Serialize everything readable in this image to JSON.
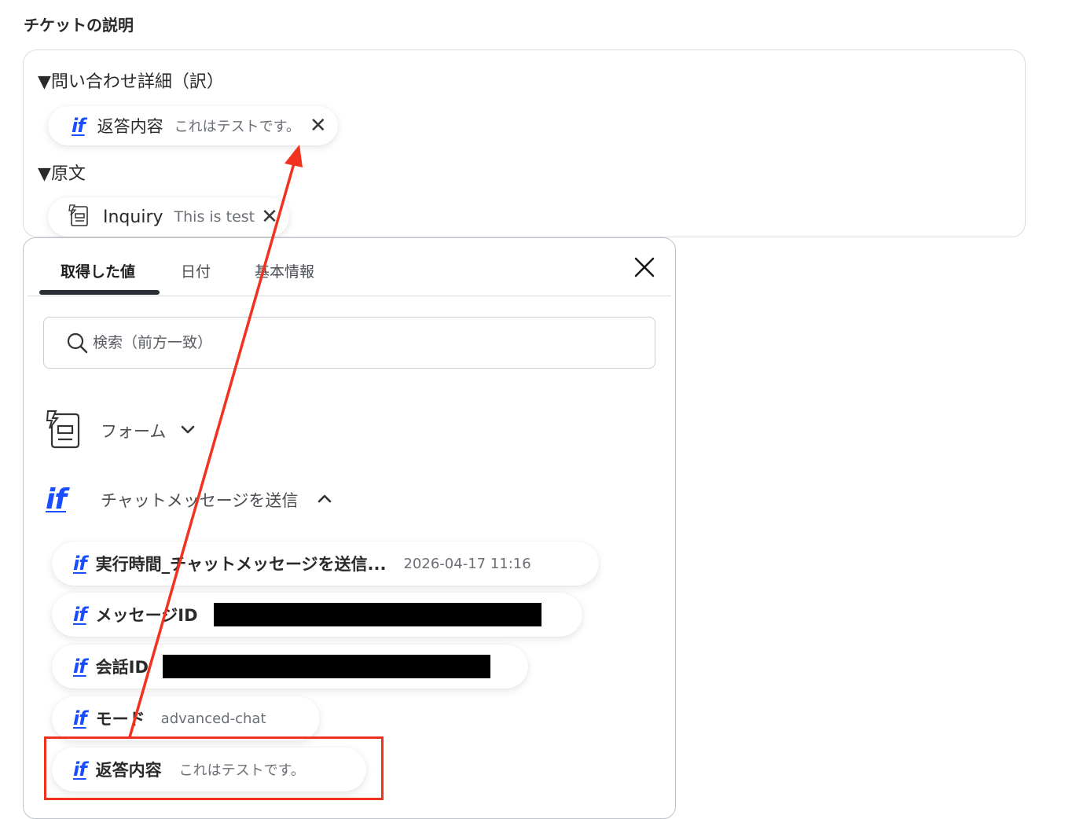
{
  "section_title": "チケットの説明",
  "description": {
    "translation_heading": "▼問い合わせ詳細（訳）",
    "translation_chip": {
      "icon": "if-icon",
      "icon_text": "if",
      "label": "返答内容",
      "value": "これはテストです。",
      "remove": "✕"
    },
    "original_heading": "▼原文",
    "original_chip": {
      "icon": "form-document-icon",
      "label": "Inquiry",
      "value": "This is test",
      "remove": "✕"
    }
  },
  "panel": {
    "tabs": [
      {
        "label": "取得した値",
        "active": true
      },
      {
        "label": "日付",
        "active": false
      },
      {
        "label": "基本情報",
        "active": false
      }
    ],
    "close": "close-icon",
    "search": {
      "placeholder": "検索（前方一致）",
      "value": ""
    },
    "groups": [
      {
        "label": "フォーム",
        "icon": "form-document-icon",
        "state": "collapsed",
        "chevron": "chevron-down-icon"
      },
      {
        "label": "チャットメッセージを送信",
        "icon": "if-icon",
        "icon_text": "if",
        "state": "expanded",
        "chevron": "chevron-up-icon"
      }
    ],
    "items": [
      {
        "icon_text": "if",
        "label": "実行時間_チャットメッセージを送信...",
        "value": "2026-04-17 11:16"
      },
      {
        "icon_text": "if",
        "label": "メッセージID",
        "value": "",
        "redacted": true
      },
      {
        "icon_text": "if",
        "label": "会話ID",
        "value": "",
        "redacted": true
      },
      {
        "icon_text": "if",
        "label": "モード",
        "value": "advanced-chat"
      },
      {
        "icon_text": "if",
        "label": "返答内容",
        "value": "これはテストです。",
        "highlighted": true
      }
    ]
  },
  "annotation": {
    "arrow_color": "#f0321e",
    "highlight_color": "#f0321e"
  },
  "colors": {
    "accent": "#1a4dff",
    "text": "#2a2a2a",
    "muted": "#6b6f76",
    "border": "#d9dde3"
  }
}
